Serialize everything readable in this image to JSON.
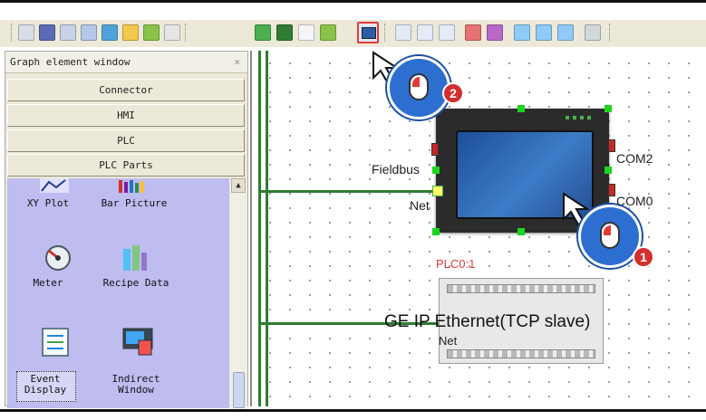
{
  "panel": {
    "title": "Graph element window",
    "close_label": "×",
    "categories": [
      "Connector",
      "HMI",
      "PLC",
      "PLC Parts"
    ]
  },
  "items": [
    {
      "label": "XY Plot",
      "icon": "xy-plot-icon"
    },
    {
      "label": "Bar Picture",
      "icon": "bar-picture-icon"
    },
    {
      "label": "Meter",
      "icon": "meter-icon"
    },
    {
      "label": "Recipe Data",
      "icon": "recipe-data-icon"
    },
    {
      "label": "Event\nDisplay",
      "icon": "event-display-icon"
    },
    {
      "label": "Indirect\nWindow",
      "icon": "indirect-window-icon"
    }
  ],
  "canvas": {
    "fieldbus_label": "Fieldbus",
    "net_label": "Net",
    "com2_label": "COM2",
    "com0_label": "COM0",
    "plc_name": "PLC0:1",
    "plc_driver": "GE IP Ethernet(TCP slave)",
    "plc_net_label": "Net"
  },
  "callouts": [
    "1",
    "2"
  ],
  "colors": {
    "accent_green": "#2e7d32",
    "highlight_red": "#e53935",
    "items_bg": "#bfbcf0"
  }
}
